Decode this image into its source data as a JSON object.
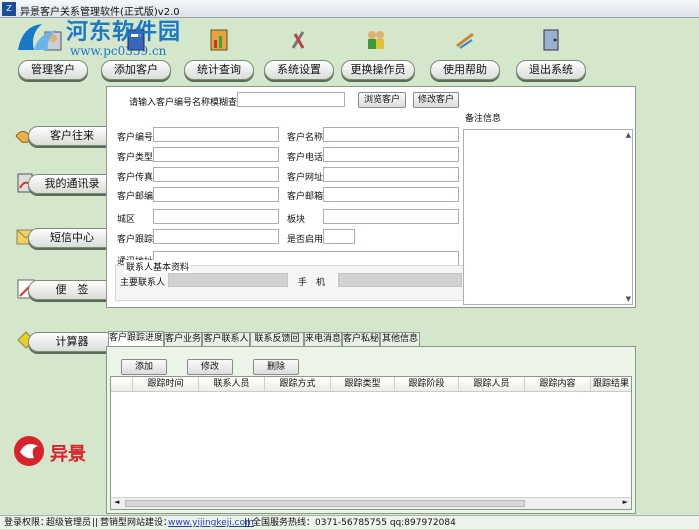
{
  "window": {
    "title": "异景客户关系管理软件(正式版)v2.0"
  },
  "watermark": {
    "name": "河东软件园",
    "url": "www.pc0359.cn"
  },
  "toolbar": [
    {
      "label": "管理客户",
      "icon": "customer-manage-icon"
    },
    {
      "label": "添加客户",
      "icon": "add-customer-icon"
    },
    {
      "label": "统计查询",
      "icon": "stats-query-icon"
    },
    {
      "label": "系统设置",
      "icon": "tools-icon"
    },
    {
      "label": "更换操作员",
      "icon": "users-icon"
    },
    {
      "label": "使用帮助",
      "icon": "help-icon"
    },
    {
      "label": "退出系统",
      "icon": "exit-icon"
    }
  ],
  "sidebar": [
    {
      "label": "客户往来",
      "icon": "handshake-icon"
    },
    {
      "label": "我的通讯录",
      "icon": "phone-book-icon"
    },
    {
      "label": "短信中心",
      "icon": "sms-icon"
    },
    {
      "label": "便　签",
      "icon": "memo-icon"
    },
    {
      "label": "计算器",
      "icon": "calculator-icon"
    }
  ],
  "brand": {
    "logo_text": "异景"
  },
  "search": {
    "label": "请输入客户编号名称模糊查询",
    "value": "",
    "browse_button": "浏览客户",
    "edit_button": "修改客户"
  },
  "notes": {
    "label": "备注信息"
  },
  "form": {
    "customer_no": "客户编号",
    "customer_name": "客户名称",
    "customer_type": "客户类型",
    "customer_phone": "客户电话",
    "customer_fax": "客户传真",
    "customer_website": "客户网址",
    "customer_zip": "客户邮编",
    "customer_email": "客户邮箱",
    "district": "城区",
    "sector": "板块",
    "customer_tracking": "客户跟踪",
    "enabled": "是否启用",
    "address": "通讯地址"
  },
  "contact_group": {
    "title": "联系人基本资料",
    "main_contact": "主要联系人",
    "mobile": "手　机"
  },
  "tabs": [
    "客户跟踪进度",
    "客户业务",
    "客户联系人",
    "联系反馈回访",
    "来电消息",
    "客户私秘",
    "其他信息"
  ],
  "tab_actions": {
    "add": "添加",
    "edit": "修改",
    "delete": "删除"
  },
  "grid": {
    "columns": [
      "跟踪时间",
      "联系人员",
      "跟踪方式",
      "跟踪类型",
      "跟踪阶段",
      "跟踪人员",
      "跟踪内容",
      "跟踪结果"
    ]
  },
  "status": {
    "login_perm_label": "登录权限：",
    "login_perm_value": "超级管理员",
    "site_label": "营销型网站建设：",
    "site_url": "www.yijingkeji.com",
    "hotline": "全国服务热线：0371-56785755 qq:897972084"
  },
  "colors": {
    "background": "#d4e6cc",
    "accent_blue": "#1a78c8",
    "brand_red": "#d8232a"
  }
}
